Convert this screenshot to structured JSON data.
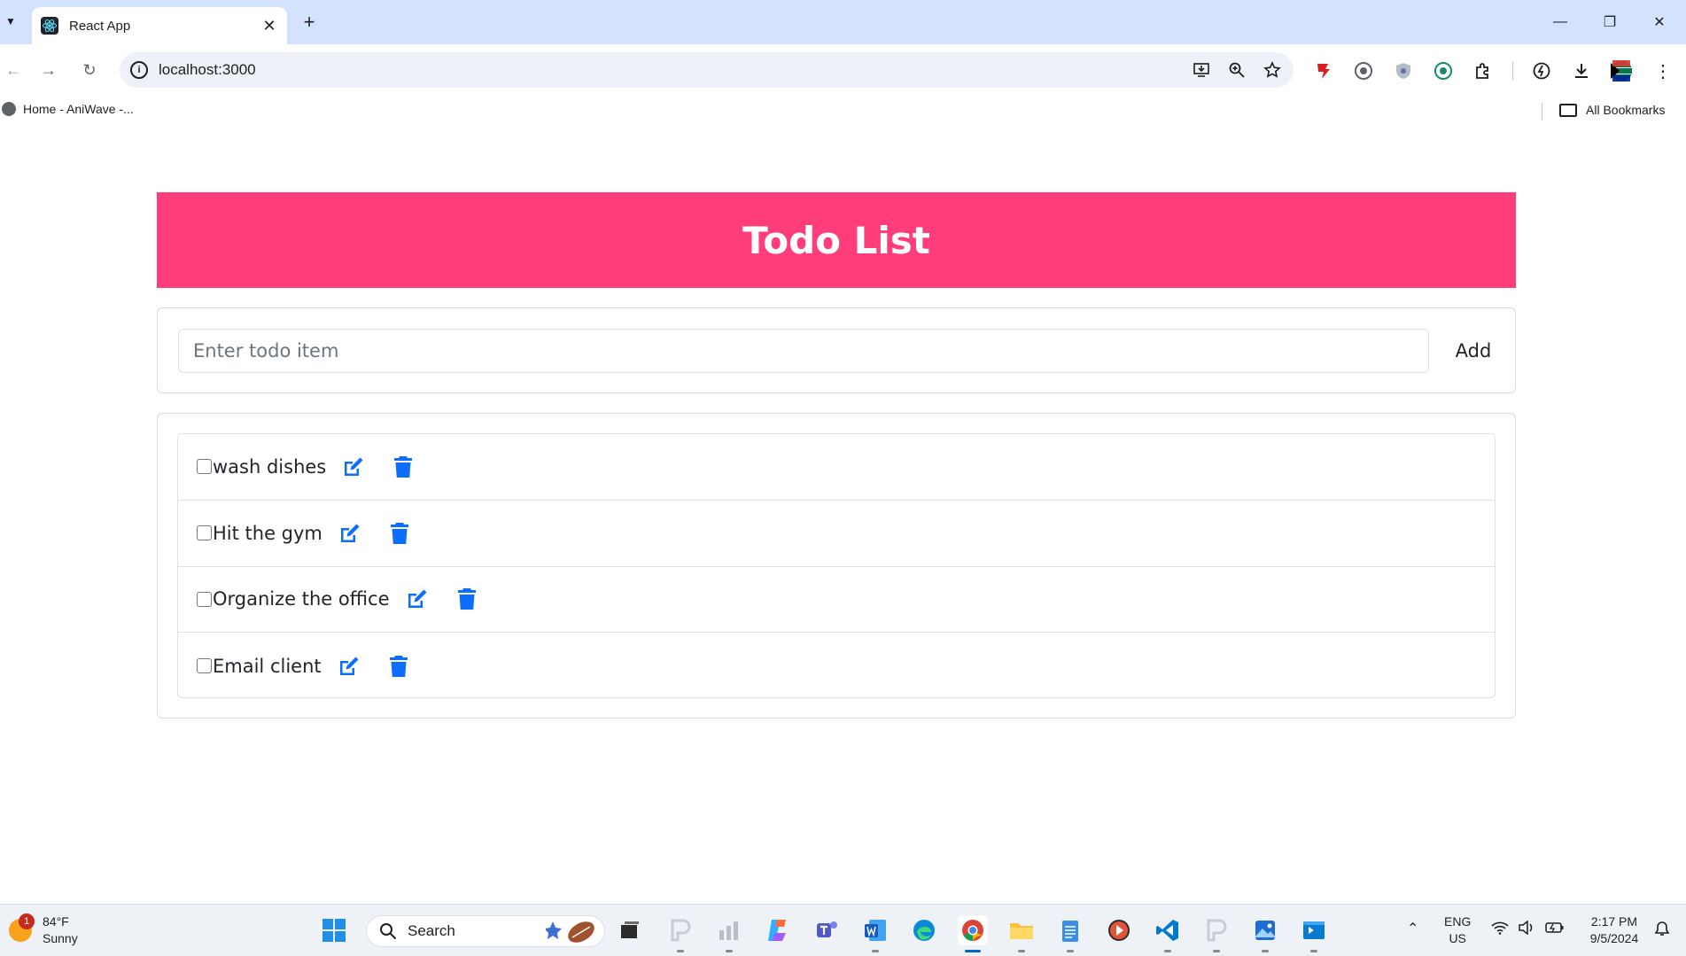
{
  "browser": {
    "tab_title": "React App",
    "url": "localhost:3000",
    "bookmark": "Home - AniWave -...",
    "all_bookmarks": "All Bookmarks"
  },
  "app": {
    "title": "Todo List",
    "input_placeholder": "Enter todo item",
    "add_label": "Add",
    "accent_color": "#ff3d7a",
    "icon_color": "#0d6efd",
    "todos": [
      {
        "text": "wash dishes",
        "done": false
      },
      {
        "text": "Hit the gym",
        "done": false
      },
      {
        "text": "Organize the office",
        "done": false
      },
      {
        "text": "Email client",
        "done": false
      }
    ]
  },
  "taskbar": {
    "temperature": "84°F",
    "condition": "Sunny",
    "weather_badge": "1",
    "search_label": "Search",
    "language": "ENG",
    "region": "US",
    "time": "2:17 PM",
    "date": "9/5/2024"
  }
}
